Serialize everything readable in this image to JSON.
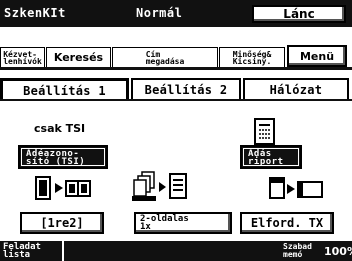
{
  "header": {
    "app_name": "SzkenKIt",
    "mode": "Normál",
    "underscore": "_",
    "chain_button": "Lánc"
  },
  "top_tabs": [
    {
      "label": "Kézvet-\nlenhívók"
    },
    {
      "label": "Keresés"
    },
    {
      "label": "Cím\nmegadása"
    },
    {
      "label": "Minőség&\nKicsiny."
    },
    {
      "label": "Menü"
    }
  ],
  "sub_tabs": [
    {
      "label": "Beállítás 1",
      "active": true
    },
    {
      "label": "Beállítás 2",
      "active": false
    },
    {
      "label": "Hálózat",
      "active": false
    }
  ],
  "body": {
    "tsi_label": "csak TSI",
    "tsi_button": "Adéazono-\nsító (TSI)",
    "report_button": "Adás\nriport",
    "mode_button": "[1re2]",
    "sides_button": "2-oldalas\n1x",
    "rotate_button": "Elford. TX",
    "icons": [
      "two-page-scan-icon",
      "document-feeder-icon",
      "fax-report-icon",
      "rotate-page-icon"
    ]
  },
  "footer": {
    "task_button": "Feladat\nlista",
    "free_memory_label": "Szabad\nmemó",
    "free_memory_value": "100%"
  }
}
